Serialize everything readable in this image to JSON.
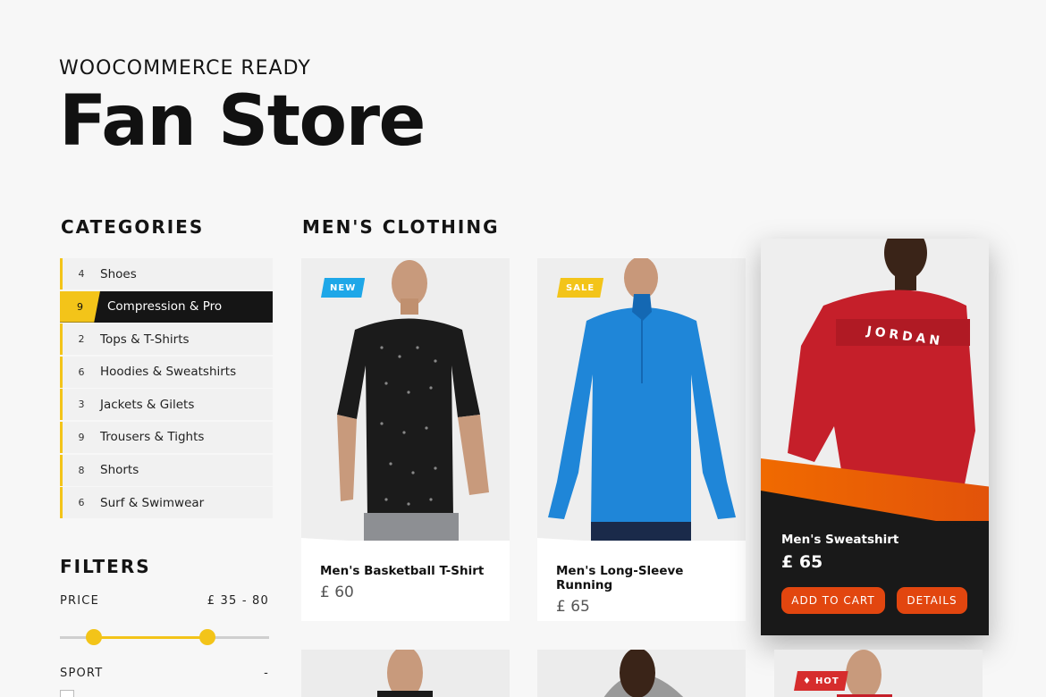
{
  "header": {
    "kicker": "WOOCOMMERCE READY",
    "title": "Fan Store"
  },
  "sidebar": {
    "categories_title": "CATEGORIES",
    "categories": [
      {
        "count": "4",
        "label": "Shoes"
      },
      {
        "count": "9",
        "label": "Compression & Pro",
        "active": true
      },
      {
        "count": "2",
        "label": "Tops & T-Shirts"
      },
      {
        "count": "6",
        "label": "Hoodies & Sweatshirts"
      },
      {
        "count": "3",
        "label": "Jackets & Gilets"
      },
      {
        "count": "9",
        "label": "Trousers & Tights"
      },
      {
        "count": "8",
        "label": "Shorts"
      },
      {
        "count": "6",
        "label": "Surf & Swimwear"
      }
    ],
    "filters_title": "FILTERS",
    "price_label": "PRICE",
    "price_range": "£ 35 - 80",
    "sport_label": "SPORT",
    "sport_toggle": "-"
  },
  "main": {
    "section_title": "MEN'S CLOTHING",
    "products": [
      {
        "name": "Men's Basketball T-Shirt",
        "price": "£ 60",
        "badge": "NEW",
        "badge_color": "#1ea7e8",
        "shirt_color": "#1b1b1b"
      },
      {
        "name": "Men's Long-Sleeve Running",
        "price": "£ 65",
        "badge": "SALE",
        "badge_color": "#f3c419",
        "shirt_color": "#1f86d8"
      }
    ],
    "featured": {
      "name": "Men's Sweatshirt",
      "price": "£ 65",
      "add_to_cart": "ADD TO CART",
      "details": "DETAILS",
      "shirt_text": "JORDAN",
      "shirt_color": "#c51f2a"
    },
    "hot_badge": "HOT"
  },
  "colors": {
    "accent_yellow": "#f3c419",
    "accent_orange": "#e2460f",
    "dark": "#151515"
  }
}
